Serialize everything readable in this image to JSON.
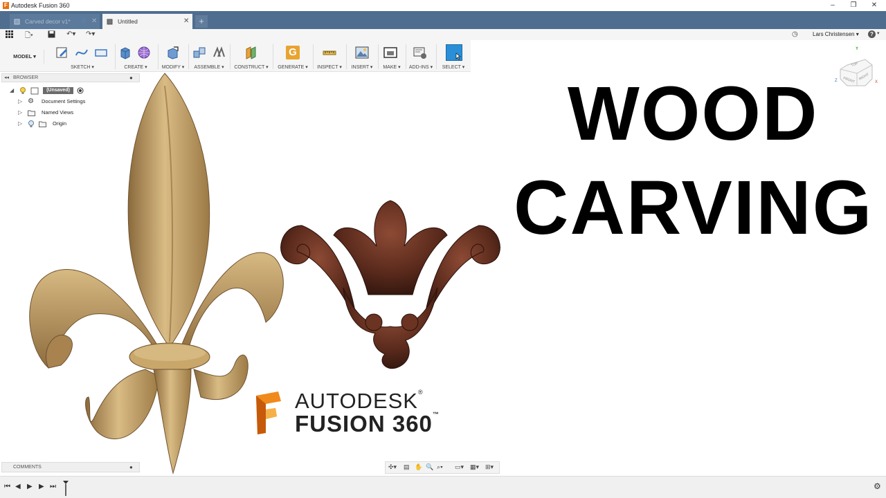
{
  "window": {
    "title": "Autodesk Fusion 360",
    "app_icon_letter": "F"
  },
  "tabs": [
    {
      "label": "Carved decor v1*",
      "active": false
    },
    {
      "label": "Untitled",
      "active": true
    }
  ],
  "quick_access": {
    "user": "Lars Christensen",
    "help": "?"
  },
  "toolbar": {
    "workspace": "MODEL ▾",
    "groups": [
      {
        "label": "SKETCH ▾"
      },
      {
        "label": "CREATE ▾"
      },
      {
        "label": "MODIFY ▾"
      },
      {
        "label": "ASSEMBLE ▾"
      },
      {
        "label": "CONSTRUCT ▾"
      },
      {
        "label": "GENERATE ▾"
      },
      {
        "label": "INSPECT ▾"
      },
      {
        "label": "INSERT ▾"
      },
      {
        "label": "MAKE ▾"
      },
      {
        "label": "ADD-INS ▾"
      },
      {
        "label": "SELECT ▾"
      }
    ],
    "generate_letter": "G"
  },
  "browser": {
    "header": "BROWSER",
    "root": "(Unsaved)",
    "items": [
      "Document Settings",
      "Named Views",
      "Origin"
    ]
  },
  "comments": {
    "header": "COMMENTS"
  },
  "overlay": {
    "headline_1": "WOOD",
    "headline_2": "CARVING",
    "logo_line_1": "AUTODESK",
    "logo_line_2": "FUSION 360",
    "trademark_1": "®",
    "trademark_2": "™"
  },
  "viewcube": {
    "top": "TOP",
    "front": "FRONT",
    "right": "RIGHT"
  },
  "colors": {
    "tab_bar": "#4f6d8f",
    "accent_orange": "#e8700e",
    "select_blue": "#2a8fd6",
    "light_wood": "#c8a56a",
    "dark_wood": "#5a2a1c"
  }
}
